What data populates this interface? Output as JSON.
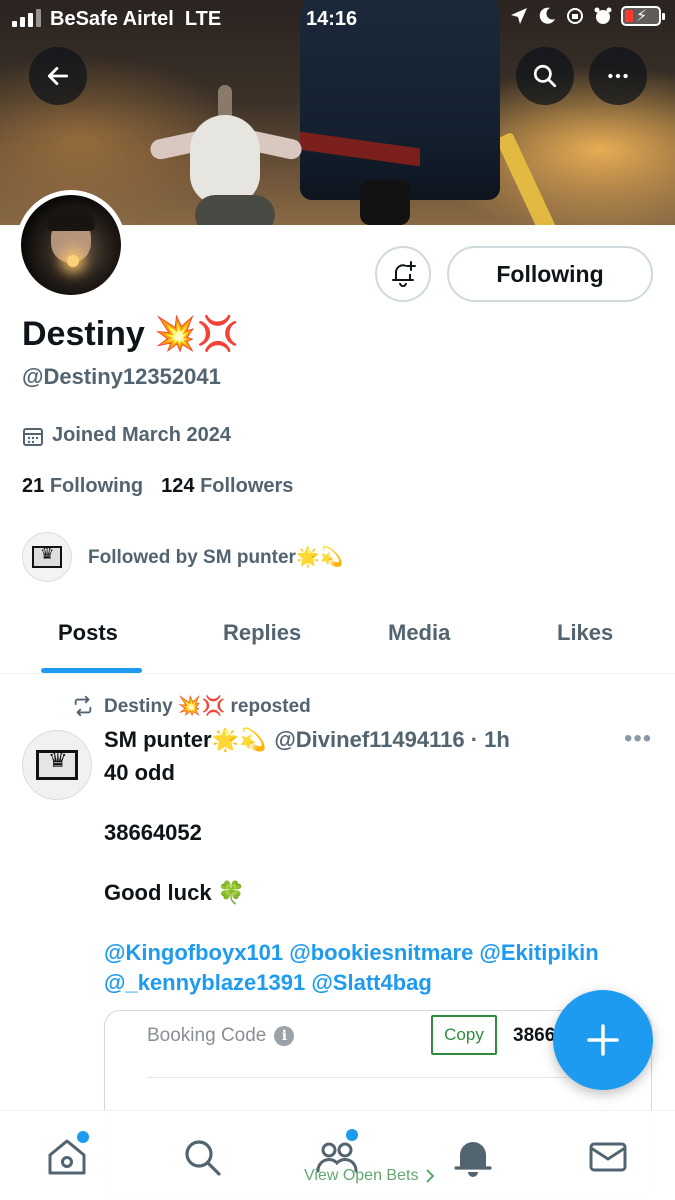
{
  "status_bar": {
    "carrier": "BeSafe Airtel",
    "network": "LTE",
    "time": "14:16"
  },
  "icons": {
    "back": "back-arrow-icon",
    "search": "search-icon",
    "more": "more-icon",
    "notify": "bell-plus-icon",
    "calendar": "calendar-icon",
    "repost": "repost-icon",
    "info": "info-icon",
    "compose": "plus-icon",
    "nav": [
      "home-icon",
      "search-icon",
      "communities-icon",
      "bell-icon",
      "mail-icon"
    ]
  },
  "colors": {
    "accent": "#1d9bf0",
    "secondary_text": "#536471",
    "copy_green": "#2e8b3e"
  },
  "profile": {
    "name": "Destiny 💥💢",
    "handle": "@Destiny12352041",
    "joined": "Joined March 2024",
    "following_count": "21",
    "following_label": "Following",
    "followers_count": "124",
    "followers_label": "Followers",
    "followed_by": "Followed by SM punter🌟💫",
    "follow_button_label": "Following"
  },
  "tabs": [
    {
      "label": "Posts",
      "active": true
    },
    {
      "label": "Replies",
      "active": false
    },
    {
      "label": "Media",
      "active": false
    },
    {
      "label": "Likes",
      "active": false
    }
  ],
  "post": {
    "repost_text": "Destiny 💥💢 reposted",
    "author_name": "SM punter🌟💫",
    "author_meta": "@Divinef11494116 · 1h",
    "more_label": "•••",
    "lines": [
      "40 odd",
      "38664052",
      "Good luck 🍀"
    ],
    "mentions_line1": "@Kingofboyx101 @bookiesnitmare @Ekitipikin",
    "mentions_line2": "@_kennyblaze1391 @Slatt4bag",
    "card": {
      "label": "Booking Code",
      "copy_label": "Copy",
      "code_partial": "3866"
    }
  },
  "bottom_nav": {
    "overlay_text": "View Open Bets"
  }
}
